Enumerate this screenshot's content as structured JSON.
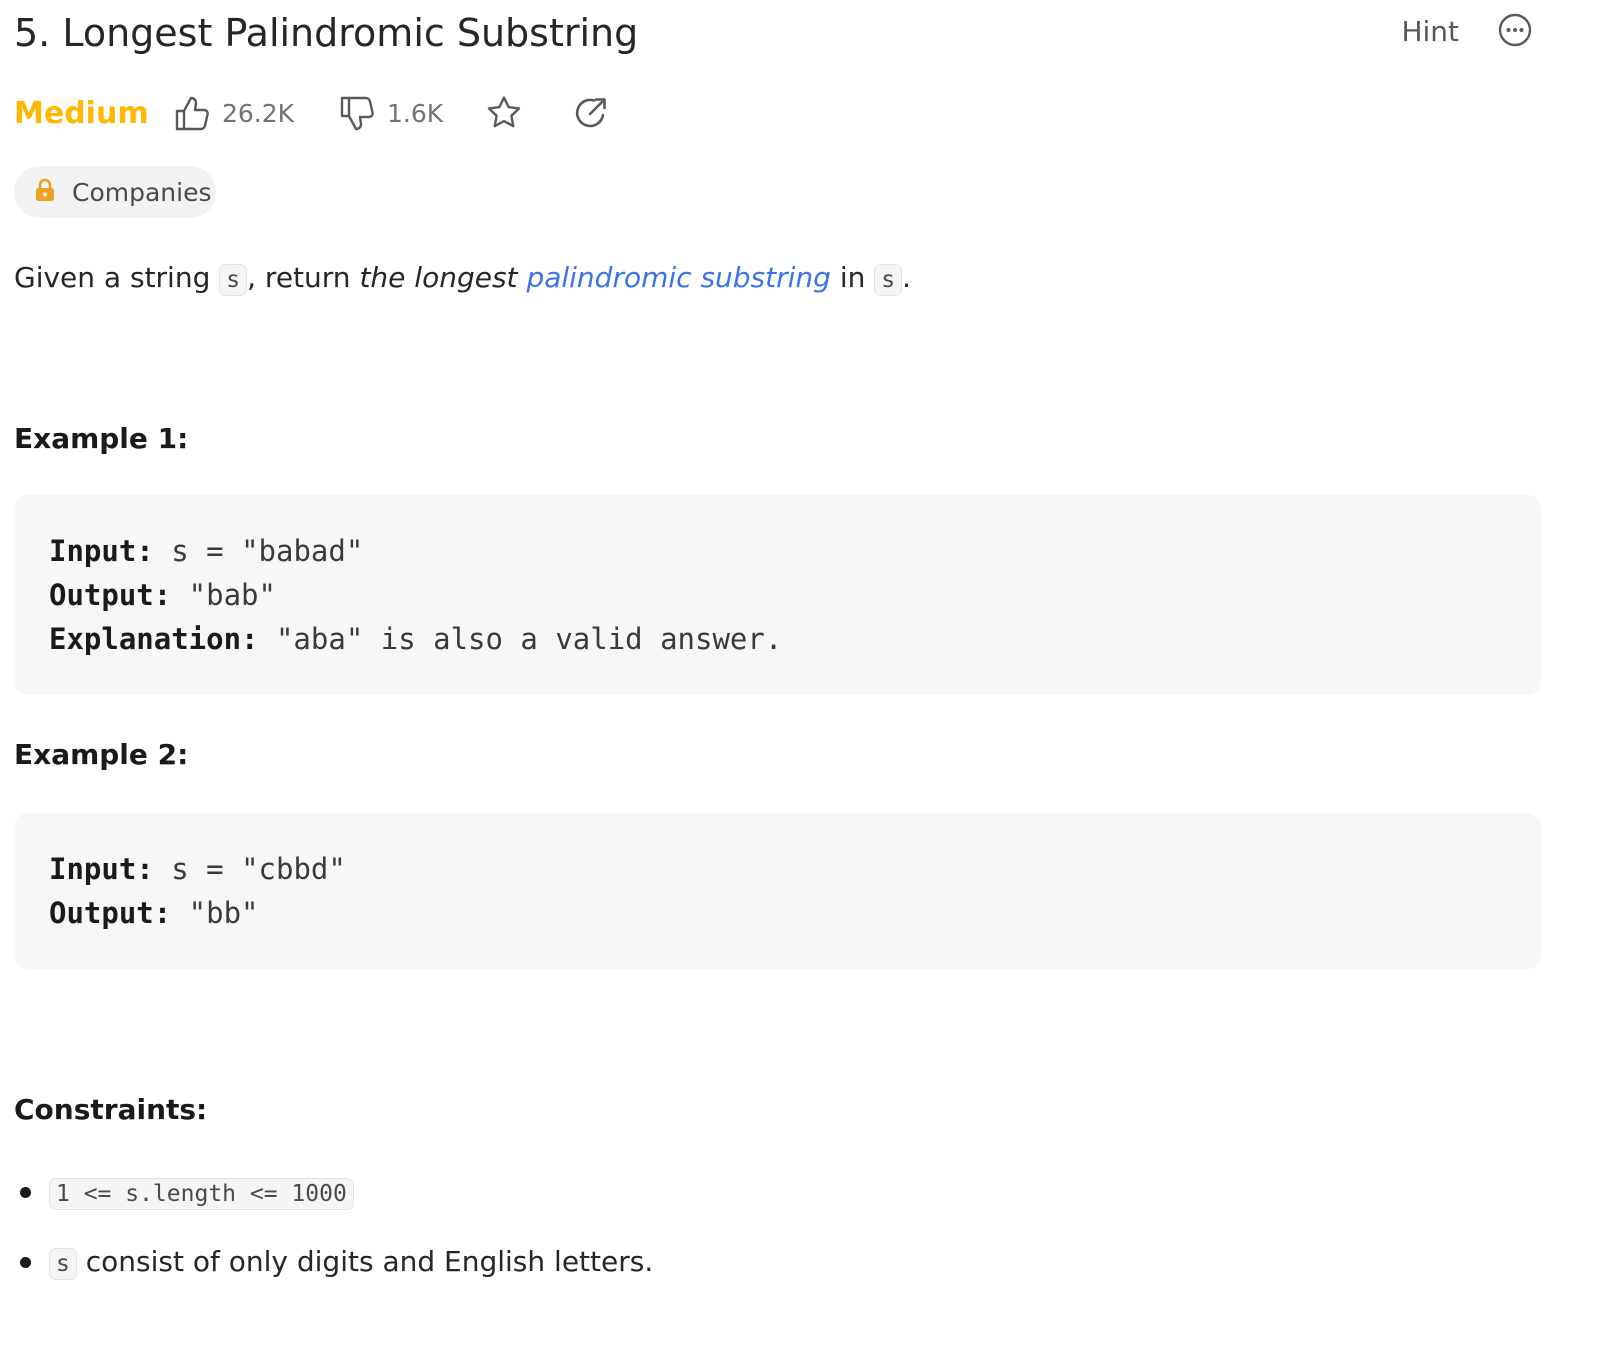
{
  "problem": {
    "title": "5. Longest Palindromic Substring",
    "hint_label": "Hint",
    "difficulty": "Medium",
    "likes": "26.2K",
    "dislikes": "1.6K",
    "companies_label": "Companies"
  },
  "description": {
    "part1": "Given a string ",
    "code1": "s",
    "part2": ", return ",
    "emph": "the longest ",
    "link": "palindromic substring",
    "part3": " in ",
    "code2": "s",
    "part4": "."
  },
  "examples": [
    {
      "heading": "Example 1:",
      "input_label": "Input:",
      "input_value": " s = \"babad\"",
      "output_label": "Output:",
      "output_value": " \"bab\"",
      "explanation_label": "Explanation:",
      "explanation_value": " \"aba\" is also a valid answer."
    },
    {
      "heading": "Example 2:",
      "input_label": "Input:",
      "input_value": " s = \"cbbd\"",
      "output_label": "Output:",
      "output_value": " \"bb\""
    }
  ],
  "constraints": {
    "heading": "Constraints:",
    "c1_code": "1 <= s.length <= 1000",
    "c2_code": "s",
    "c2_text": " consist of only digits and English letters."
  },
  "colors": {
    "difficulty_medium": "#ffb800",
    "link": "#3c73e9",
    "lock": "#f0a020"
  },
  "icons": [
    "more-options-icon",
    "thumbs-up-icon",
    "thumbs-down-icon",
    "star-icon",
    "share-icon",
    "lock-icon"
  ]
}
